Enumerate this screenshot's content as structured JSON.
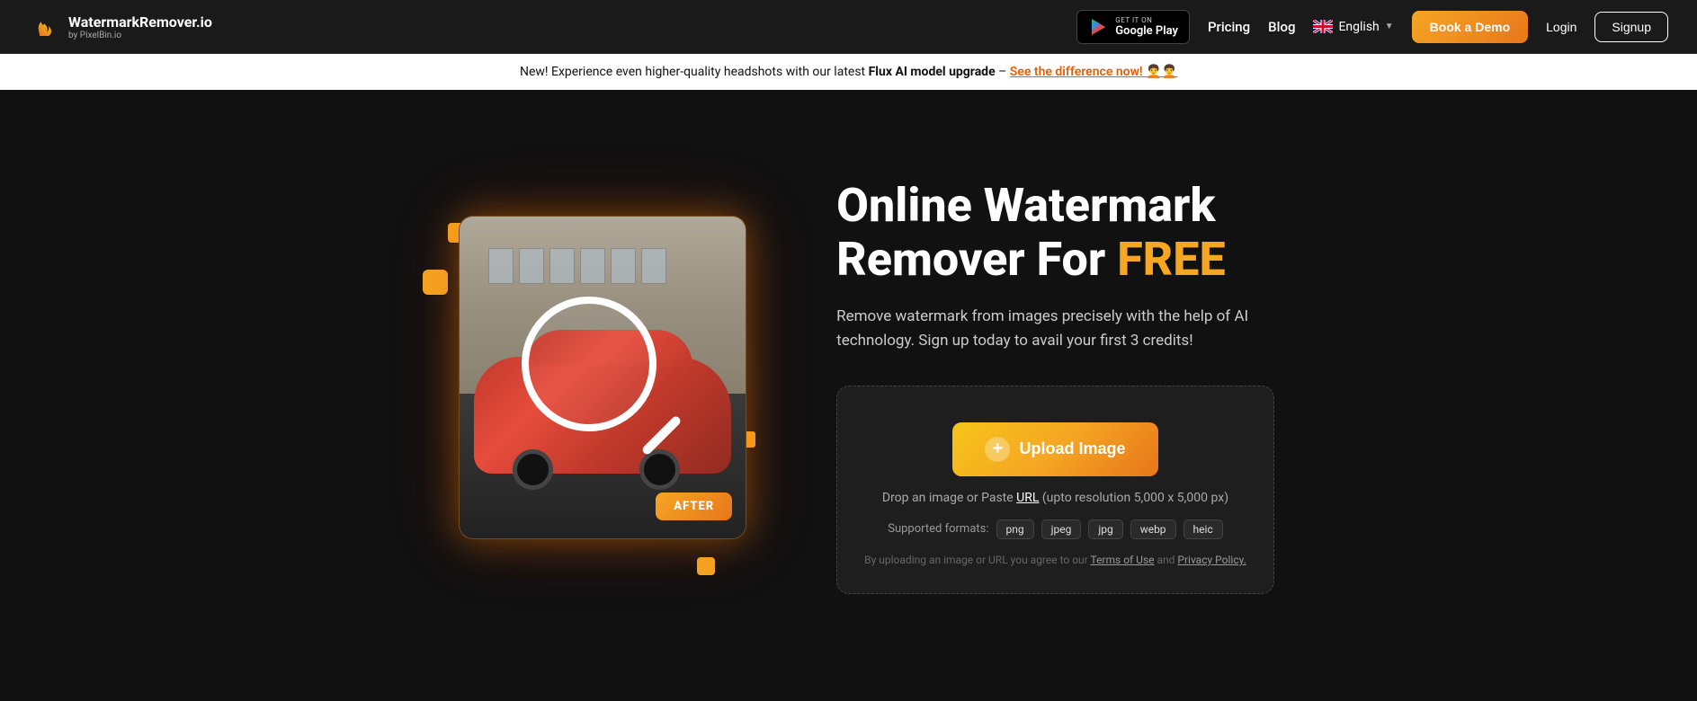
{
  "navbar": {
    "logo_main": "WatermarkRemover.io",
    "logo_sub": "by PixelBin.io",
    "google_play_get": "GET IT ON",
    "google_play_store": "Google Play",
    "pricing_label": "Pricing",
    "blog_label": "Blog",
    "language_label": "English",
    "book_demo_label": "Book a Demo",
    "login_label": "Login",
    "signup_label": "Signup"
  },
  "announcement": {
    "text_normal": "New! Experience even higher-quality headshots with our latest ",
    "text_bold": "Flux AI model upgrade",
    "text_dash": " – ",
    "link_text": "See the difference now!",
    "emoji": "🧑‍🦱🧑‍🦱"
  },
  "hero": {
    "title_line1": "Online Watermark",
    "title_line2_normal": "Remover For ",
    "title_line2_colored": "FREE",
    "subtitle": "Remove watermark from images precisely with the help of AI technology. Sign up today to avail your first 3 credits!",
    "after_badge": "AFTER"
  },
  "upload": {
    "button_label": "Upload Image",
    "button_plus": "+",
    "drop_text_normal": "Drop an image or Paste ",
    "drop_url": "URL",
    "drop_text_after": " (upto resolution 5,000 x 5,000 px)",
    "formats_label": "Supported formats:",
    "formats": [
      "png",
      "jpeg",
      "jpg",
      "webp",
      "heic"
    ],
    "terms_text_before": "By uploading an image or URL you agree to our ",
    "terms_of_use": "Terms of Use",
    "terms_and": " and ",
    "privacy_policy": "Privacy Policy."
  }
}
